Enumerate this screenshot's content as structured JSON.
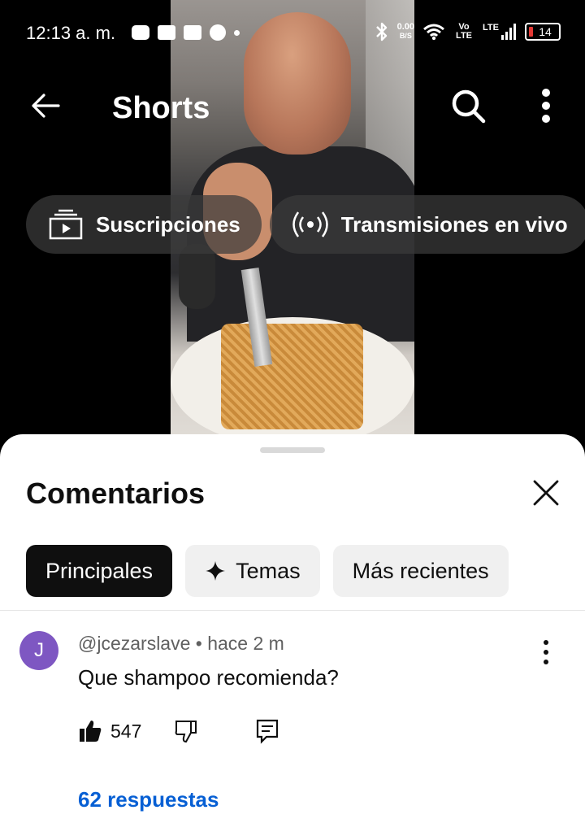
{
  "status_bar": {
    "time": "12:13 a. m.",
    "net_speed_value": "0.00",
    "net_speed_unit": "B/S",
    "volte": "Vo LTE",
    "network": "LTE",
    "battery": "14"
  },
  "nav": {
    "title": "Shorts"
  },
  "video_chips": [
    {
      "label": "Suscripciones",
      "icon": "subscriptions-icon"
    },
    {
      "label": "Transmisiones en vivo",
      "icon": "live-icon"
    }
  ],
  "comments_sheet": {
    "title": "Comentarios",
    "filters": [
      {
        "label": "Principales",
        "active": true
      },
      {
        "label": "Temas",
        "active": false,
        "icon": "sparkle-icon"
      },
      {
        "label": "Más recientes",
        "active": false
      }
    ],
    "comments": [
      {
        "avatar_letter": "J",
        "avatar_color": "#7e57c2",
        "author": "@jcezarslave",
        "time": "hace 2 m",
        "meta": "@jcezarslave • hace 2 m",
        "text": "Que shampoo recomienda?",
        "likes": "547",
        "replies": "62 respuestas"
      }
    ]
  },
  "colors": {
    "accent_link": "#065fd4",
    "active_chip": "#0f0f0f",
    "inactive_chip": "#f0f0f0"
  }
}
